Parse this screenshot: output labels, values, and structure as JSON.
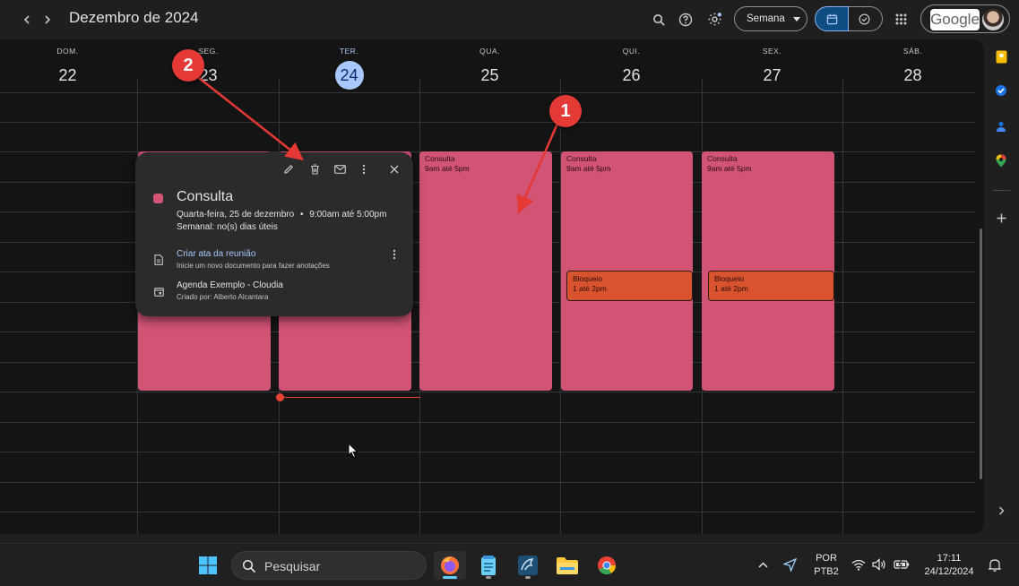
{
  "header": {
    "title": "Dezembro de 2024",
    "view_label": "Semana",
    "google_label": "Google"
  },
  "days": [
    {
      "dow": "DOM.",
      "num": "22"
    },
    {
      "dow": "SEG.",
      "num": "23"
    },
    {
      "dow": "TER.",
      "num": "24",
      "today": true
    },
    {
      "dow": "QUA.",
      "num": "25"
    },
    {
      "dow": "QUI.",
      "num": "26"
    },
    {
      "dow": "SEX.",
      "num": "27"
    },
    {
      "dow": "SÁB.",
      "num": "28"
    }
  ],
  "events": {
    "wed": {
      "title": "Consulta",
      "time": "9am até 5pm"
    },
    "thu": {
      "title": "Consulta",
      "time": "9am até 5pm"
    },
    "fri": {
      "title": "Consulta",
      "time": "9am até 5pm"
    },
    "thu_block": {
      "title": "Bloqueio",
      "time": "1 até 2pm"
    },
    "fri_block": {
      "title": "Bloqueio",
      "time": "1 até 2pm"
    }
  },
  "popover": {
    "title": "Consulta",
    "date": "Quarta-feira, 25 de dezembro",
    "separator": "•",
    "time": "9:00am até 5:00pm",
    "recurrence": "Semanal: no(s) dias úteis",
    "notes_link": "Criar ata da reunião",
    "notes_sub": "Inicie um novo documento para fazer anotações",
    "calendar": "Agenda Exemplo - Cloudia",
    "creator": "Criado por: Alberto Alcantara"
  },
  "annotations": [
    "1",
    "2"
  ],
  "taskbar": {
    "search_placeholder": "Pesquisar",
    "lang_top": "POR",
    "lang_bottom": "PTB2",
    "time": "17:11",
    "date": "24/12/2024"
  },
  "colors": {
    "event_pink": "#d25475",
    "event_orange": "#d9532f",
    "today_blue": "#a8c7fa",
    "annotation_red": "#e53935"
  }
}
